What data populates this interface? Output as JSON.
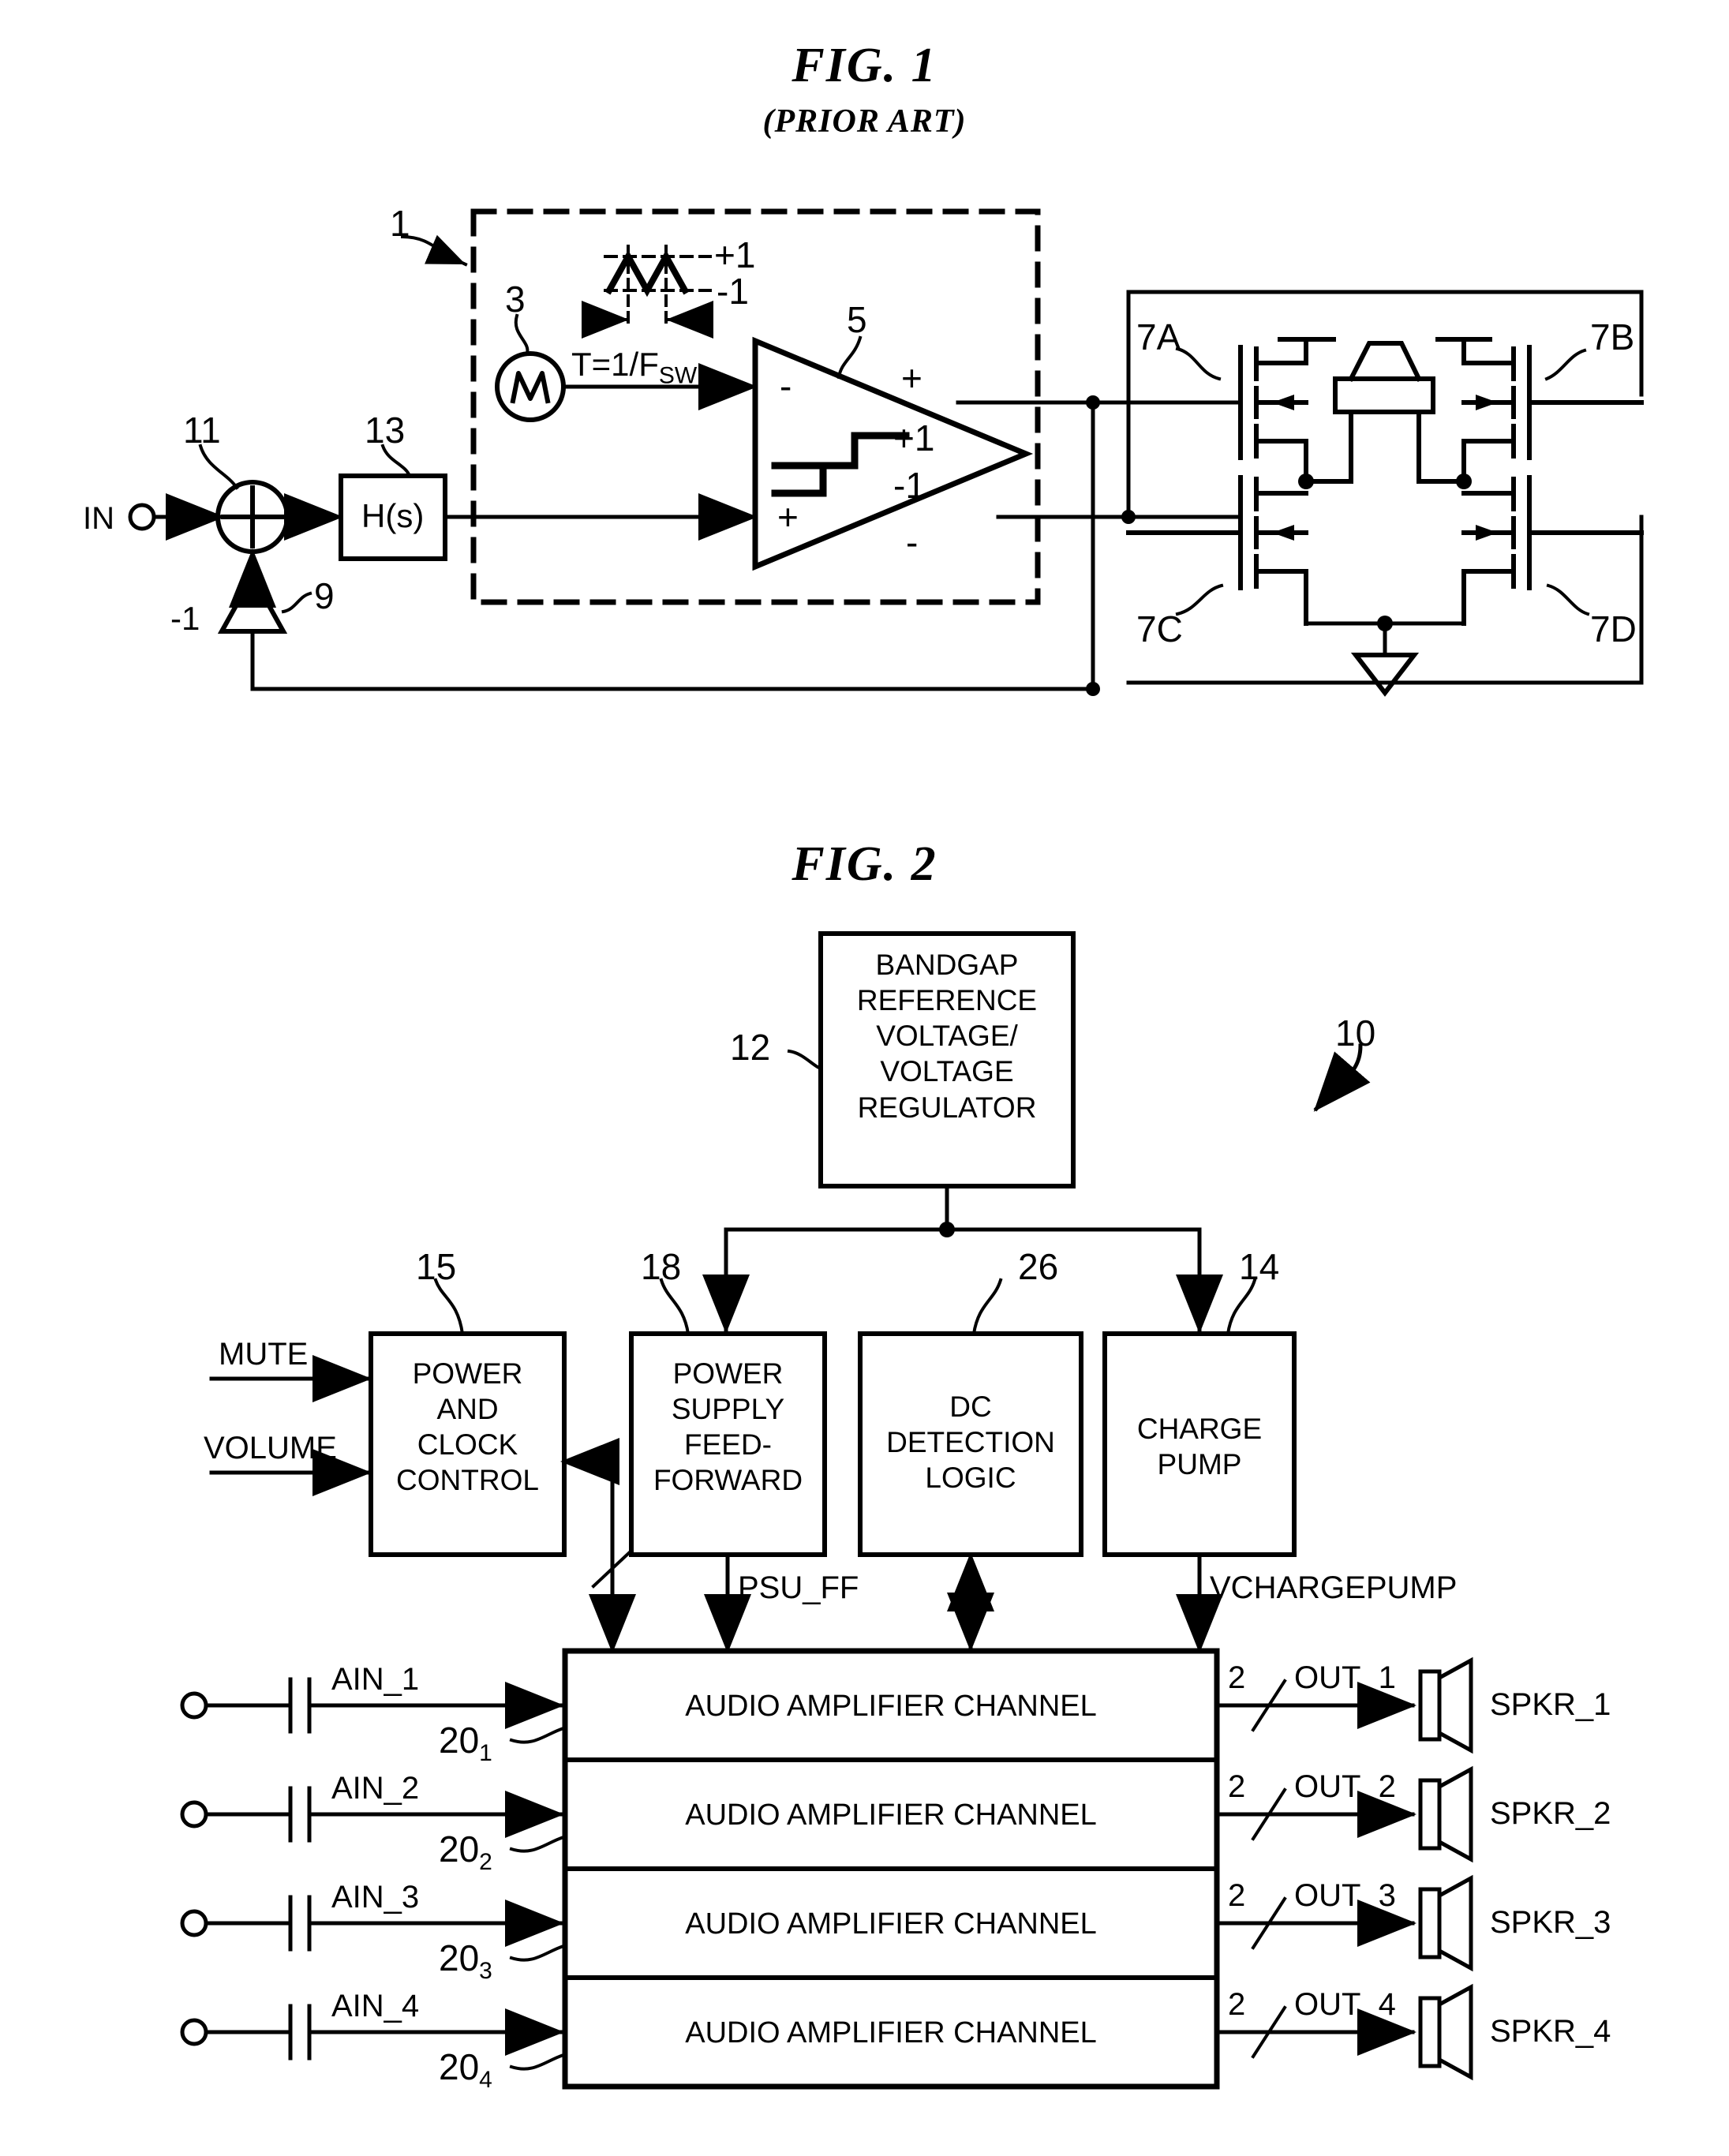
{
  "figures": {
    "fig1": {
      "title": "FIG. 1",
      "subtitle": "(PRIOR ART)",
      "refs": {
        "modulator": "1",
        "triangle_source": "3",
        "comparator": "5",
        "mosfet_a": "7A",
        "mosfet_b": "7B",
        "mosfet_c": "7C",
        "mosfet_d": "7D",
        "inverter": "9",
        "summer": "11",
        "loop_filter": "13"
      },
      "labels": {
        "input_terminal": "IN",
        "loop_filter_text": "H(s)",
        "inverter_gain": "-1",
        "period": "T=1/F",
        "period_sub": "SW",
        "tri_plus": "+1",
        "tri_minus": "-1",
        "comp_plus": "+1",
        "comp_minus": "-1",
        "comp_in_minus": "-",
        "comp_in_plus": "+",
        "comp_out_plus": "+",
        "comp_out_minus": "-"
      }
    },
    "fig2": {
      "title": "FIG. 2",
      "refs": {
        "system": "10",
        "bandgap": "12",
        "charge_pump": "14",
        "power_clock": "15",
        "psu_ff": "18",
        "dc_detect": "26",
        "channel_1": "20",
        "channel_1_sub": "1",
        "channel_2": "20",
        "channel_2_sub": "2",
        "channel_3": "20",
        "channel_3_sub": "3",
        "channel_4": "20",
        "channel_4_sub": "4"
      },
      "blocks": {
        "bandgap": "BANDGAP\nREFERENCE\nVOLTAGE/\nVOLTAGE\nREGULATOR",
        "power_clock": "POWER\nAND\nCLOCK\nCONTROL",
        "psu_ff": "POWER\nSUPPLY\nFEED-\nFORWARD",
        "dc_detect": "DC\nDETECTION\nLOGIC",
        "charge_pump": "CHARGE\nPUMP",
        "channel": "AUDIO AMPLIFIER CHANNEL"
      },
      "control_inputs": [
        "MUTE",
        "VOLUME"
      ],
      "bus_labels": {
        "psu_ff_signal": "PSU_FF",
        "charge_pump_signal": "VCHARGEPUMP",
        "out_bus_width": "2"
      },
      "inputs": [
        {
          "name": "AIN_1"
        },
        {
          "name": "AIN_2"
        },
        {
          "name": "AIN_3"
        },
        {
          "name": "AIN_4"
        }
      ],
      "outputs": [
        {
          "name": "OUT_1",
          "speaker": "SPKR_1",
          "width": "2"
        },
        {
          "name": "OUT_2",
          "speaker": "SPKR_2",
          "width": "2"
        },
        {
          "name": "OUT_3",
          "speaker": "SPKR_3",
          "width": "2"
        },
        {
          "name": "OUT_4",
          "speaker": "SPKR_4",
          "width": "2"
        }
      ]
    }
  },
  "style": {
    "ink": "#000000",
    "paper": "#ffffff"
  }
}
